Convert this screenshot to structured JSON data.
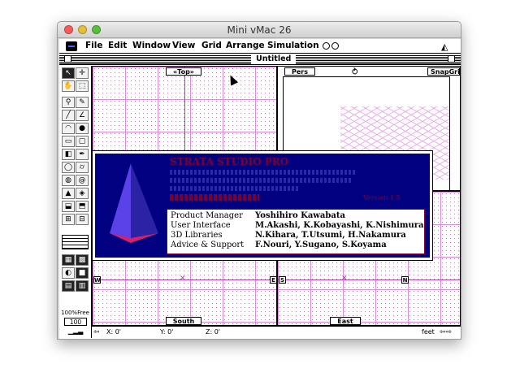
{
  "host": {
    "title": "Mini vMac 26",
    "traffic_colors": [
      "#fc5b57",
      "#e5bf3c",
      "#57c038"
    ]
  },
  "menubar": {
    "items": [
      "File",
      "Edit",
      "Window",
      "View",
      "Grid",
      "Arrange",
      "Simulation"
    ]
  },
  "document": {
    "title": "Untitled"
  },
  "views": {
    "top": "«Top»",
    "pers": "Pers",
    "snap": "SnapGrid",
    "south": "South",
    "east": "East",
    "tag_w": "W",
    "tag_e": "E",
    "tag_s": "S",
    "tag_n": "N",
    "tag_e2": "E"
  },
  "palette": {
    "zoom": "100%Free",
    "zoom_value": "100"
  },
  "statusbar": {
    "x": "X: 0'",
    "y": "Y: 0'",
    "z": "Z: 0'",
    "units": "feet"
  },
  "about": {
    "title_text": "STRATA STUDIO PRO",
    "version": "Version 1.5",
    "credits": [
      {
        "role": "Product Manager",
        "name": "Yoshihiro Kawabata"
      },
      {
        "role": "User Interface",
        "name": "M.Akashi, K.Kobayashi, K.Nishimura"
      },
      {
        "role": "3D Libraries",
        "name": "N.Kihara, T.Utsumi, H.Nakamura"
      },
      {
        "role": "Advice & Support",
        "name": "F.Nouri, Y.Sugano, S.Koyama"
      }
    ],
    "accent": "#000080"
  }
}
